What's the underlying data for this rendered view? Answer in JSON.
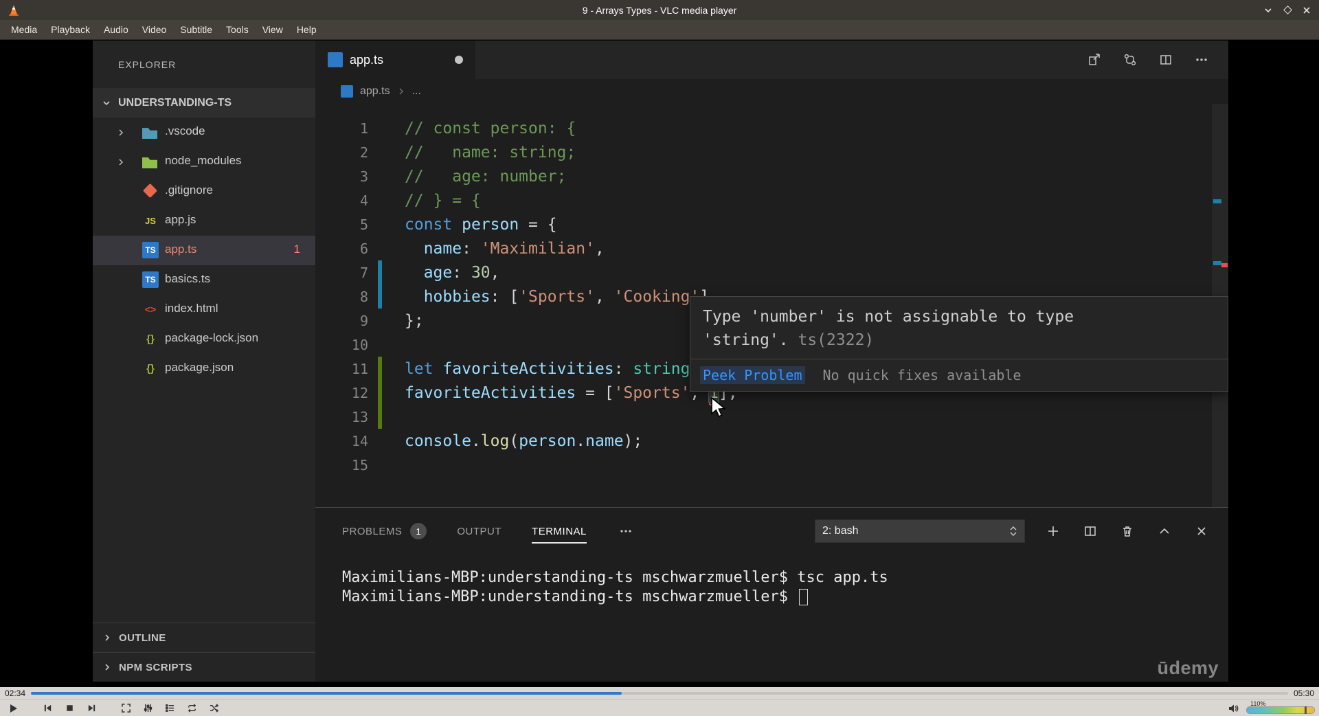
{
  "window": {
    "title": "9 - Arrays Types - VLC media player",
    "menu": [
      "Media",
      "Playback",
      "Audio",
      "Video",
      "Subtitle",
      "Tools",
      "View",
      "Help"
    ]
  },
  "sidebar": {
    "explorer_label": "EXPLORER",
    "project": "UNDERSTANDING-TS",
    "files": [
      {
        "name": ".vscode",
        "icon": "vscode-folder",
        "chevron": true
      },
      {
        "name": "node_modules",
        "icon": "node-modules-folder",
        "chevron": true
      },
      {
        "name": ".gitignore",
        "icon": "git"
      },
      {
        "name": "app.js",
        "icon": "js"
      },
      {
        "name": "app.ts",
        "icon": "ts",
        "selected": true,
        "badge": "1"
      },
      {
        "name": "basics.ts",
        "icon": "ts"
      },
      {
        "name": "index.html",
        "icon": "html"
      },
      {
        "name": "package-lock.json",
        "icon": "json"
      },
      {
        "name": "package.json",
        "icon": "json"
      }
    ],
    "outline_label": "OUTLINE",
    "npm_label": "NPM SCRIPTS"
  },
  "editor": {
    "tab": {
      "label": "app.ts"
    },
    "breadcrumb": {
      "file": "app.ts",
      "rest": "..."
    },
    "lines": [
      {
        "num": 1,
        "segs": [
          {
            "t": "// const person: {",
            "c": "comment"
          }
        ]
      },
      {
        "num": 2,
        "segs": [
          {
            "t": "//   name: string;",
            "c": "comment"
          }
        ]
      },
      {
        "num": 3,
        "segs": [
          {
            "t": "//   age: number;",
            "c": "comment"
          }
        ]
      },
      {
        "num": 4,
        "segs": [
          {
            "t": "// } = {",
            "c": "comment"
          }
        ]
      },
      {
        "num": 5,
        "segs": [
          {
            "t": "const",
            "c": "kw"
          },
          {
            "t": " ",
            "c": "plain"
          },
          {
            "t": "person",
            "c": "var"
          },
          {
            "t": " = {",
            "c": "plain"
          }
        ]
      },
      {
        "num": 6,
        "segs": [
          {
            "t": "  ",
            "c": "plain"
          },
          {
            "t": "name",
            "c": "var"
          },
          {
            "t": ": ",
            "c": "plain"
          },
          {
            "t": "'Maximilian'",
            "c": "str"
          },
          {
            "t": ",",
            "c": "plain"
          }
        ]
      },
      {
        "num": 7,
        "gutter": "modified",
        "segs": [
          {
            "t": "  ",
            "c": "plain"
          },
          {
            "t": "age",
            "c": "var"
          },
          {
            "t": ": ",
            "c": "plain"
          },
          {
            "t": "30",
            "c": "num"
          },
          {
            "t": ",",
            "c": "plain"
          }
        ]
      },
      {
        "num": 8,
        "gutter": "modified",
        "segs": [
          {
            "t": "  ",
            "c": "plain"
          },
          {
            "t": "hobbies",
            "c": "var"
          },
          {
            "t": ": [",
            "c": "plain"
          },
          {
            "t": "'Sports'",
            "c": "str"
          },
          {
            "t": ", ",
            "c": "plain"
          },
          {
            "t": "'Cooking'",
            "c": "str"
          },
          {
            "t": "]",
            "c": "plain"
          }
        ]
      },
      {
        "num": 9,
        "segs": [
          {
            "t": "};",
            "c": "plain"
          }
        ]
      },
      {
        "num": 10,
        "segs": []
      },
      {
        "num": 11,
        "gutter": "added",
        "segs": [
          {
            "t": "let",
            "c": "kw"
          },
          {
            "t": " ",
            "c": "plain"
          },
          {
            "t": "favoriteActivities",
            "c": "var"
          },
          {
            "t": ": ",
            "c": "plain"
          },
          {
            "t": "string",
            "c": "type"
          }
        ]
      },
      {
        "num": 12,
        "gutter": "added",
        "segs": [
          {
            "t": "favoriteActivities",
            "c": "var"
          },
          {
            "t": " = [",
            "c": "plain"
          },
          {
            "t": "'Sports'",
            "c": "str"
          },
          {
            "t": ", ",
            "c": "plain"
          },
          {
            "t": "1",
            "c": "num",
            "err": true
          },
          {
            "t": "];",
            "c": "plain"
          }
        ]
      },
      {
        "num": 13,
        "gutter": "added",
        "segs": []
      },
      {
        "num": 14,
        "segs": [
          {
            "t": "console",
            "c": "var"
          },
          {
            "t": ".",
            "c": "plain"
          },
          {
            "t": "log",
            "c": "fn"
          },
          {
            "t": "(",
            "c": "plain"
          },
          {
            "t": "person",
            "c": "var"
          },
          {
            "t": ".",
            "c": "plain"
          },
          {
            "t": "name",
            "c": "var"
          },
          {
            "t": ");",
            "c": "plain"
          }
        ]
      },
      {
        "num": 15,
        "segs": []
      }
    ]
  },
  "tooltip": {
    "line1": "Type 'number' is not assignable to type",
    "line2": "'string'.",
    "code": "ts(2322)",
    "peek": "Peek Problem",
    "status": "No quick fixes available"
  },
  "panel": {
    "tabs": [
      {
        "label": "PROBLEMS",
        "badge": "1"
      },
      {
        "label": "OUTPUT"
      },
      {
        "label": "TERMINAL",
        "active": true
      }
    ],
    "shell_select": "2: bash",
    "terminal_lines": [
      {
        "text": "Maximilians-MBP:understanding-ts mschwarzmueller$ tsc app.ts"
      },
      {
        "text": "Maximilians-MBP:understanding-ts mschwarzmueller$ ",
        "cursor": true
      }
    ]
  },
  "watermark": "ūdemy",
  "player": {
    "elapsed": "02:34",
    "total": "05:30",
    "progress_pct": 47,
    "volume_pct": "110%"
  },
  "colors": {
    "progress_blue": "#3377d4",
    "explorer_error": "#f48771",
    "tooltip_link": "#3794ff",
    "added_green": "#587c0c",
    "modified_blue": "#1b81a8",
    "error_red": "#f14c4c"
  }
}
